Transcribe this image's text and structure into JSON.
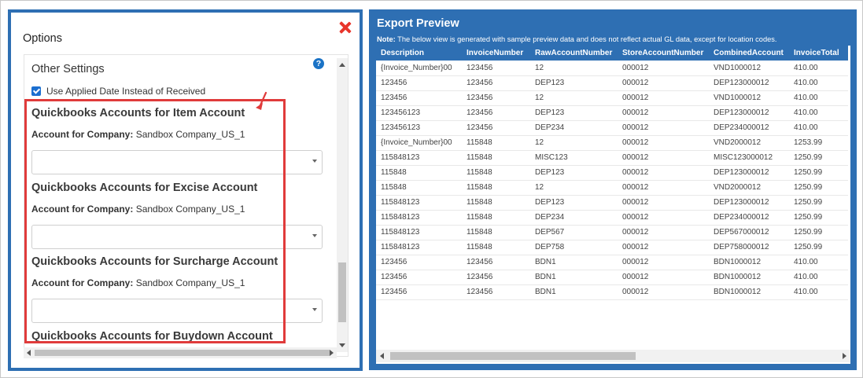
{
  "left_panel": {
    "title": "Options",
    "close_icon": "close-icon",
    "settings_heading": "Other Settings",
    "help_icon": "?",
    "checkbox": {
      "label": "Use Applied Date Instead of Received",
      "checked": true
    },
    "sections": [
      {
        "title": "Quickbooks Accounts for Item Account",
        "company_label": "Account for Company:",
        "company_value": "Sandbox Company_US_1",
        "select_value": ""
      },
      {
        "title": "Quickbooks Accounts for Excise Account",
        "company_label": "Account for Company:",
        "company_value": "Sandbox Company_US_1",
        "select_value": ""
      },
      {
        "title": "Quickbooks Accounts for Surcharge Account",
        "company_label": "Account for Company:",
        "company_value": "Sandbox Company_US_1",
        "select_value": ""
      },
      {
        "title": "Quickbooks Accounts for Buydown Account"
      }
    ]
  },
  "right_panel": {
    "title": "Export Preview",
    "note_label": "Note:",
    "note_text": " The below view is generated with sample preview data and does not reflect actual GL data, except for location codes.",
    "columns": [
      "Description",
      "InvoiceNumber",
      "RawAccountNumber",
      "StoreAccountNumber",
      "CombinedAccount",
      "InvoiceTotal"
    ],
    "rows": [
      [
        "{Invoice_Number}00",
        "123456",
        "12",
        "000012",
        "VND1000012",
        "410.00"
      ],
      [
        "123456",
        "123456",
        "DEP123",
        "000012",
        "DEP123000012",
        "410.00"
      ],
      [
        "123456",
        "123456",
        "12",
        "000012",
        "VND1000012",
        "410.00"
      ],
      [
        "123456123",
        "123456",
        "DEP123",
        "000012",
        "DEP123000012",
        "410.00"
      ],
      [
        "123456123",
        "123456",
        "DEP234",
        "000012",
        "DEP234000012",
        "410.00"
      ],
      [
        "{Invoice_Number}00",
        "115848",
        "12",
        "000012",
        "VND2000012",
        "1253.99"
      ],
      [
        "115848123",
        "115848",
        "MISC123",
        "000012",
        "MISC123000012",
        "1250.99"
      ],
      [
        "115848",
        "115848",
        "DEP123",
        "000012",
        "DEP123000012",
        "1250.99"
      ],
      [
        "115848",
        "115848",
        "12",
        "000012",
        "VND2000012",
        "1250.99"
      ],
      [
        "115848123",
        "115848",
        "DEP123",
        "000012",
        "DEP123000012",
        "1250.99"
      ],
      [
        "115848123",
        "115848",
        "DEP234",
        "000012",
        "DEP234000012",
        "1250.99"
      ],
      [
        "115848123",
        "115848",
        "DEP567",
        "000012",
        "DEP567000012",
        "1250.99"
      ],
      [
        "115848123",
        "115848",
        "DEP758",
        "000012",
        "DEP758000012",
        "1250.99"
      ],
      [
        "123456",
        "123456",
        "BDN1",
        "000012",
        "BDN1000012",
        "410.00"
      ],
      [
        "123456",
        "123456",
        "BDN1",
        "000012",
        "BDN1000012",
        "410.00"
      ],
      [
        "123456",
        "123456",
        "BDN1",
        "000012",
        "BDN1000012",
        "410.00"
      ]
    ]
  },
  "colors": {
    "frame_blue": "#2e6fb3",
    "highlight_red": "#e03b3b",
    "close_red": "#e8352b",
    "checkbox_blue": "#1b6fd0"
  }
}
